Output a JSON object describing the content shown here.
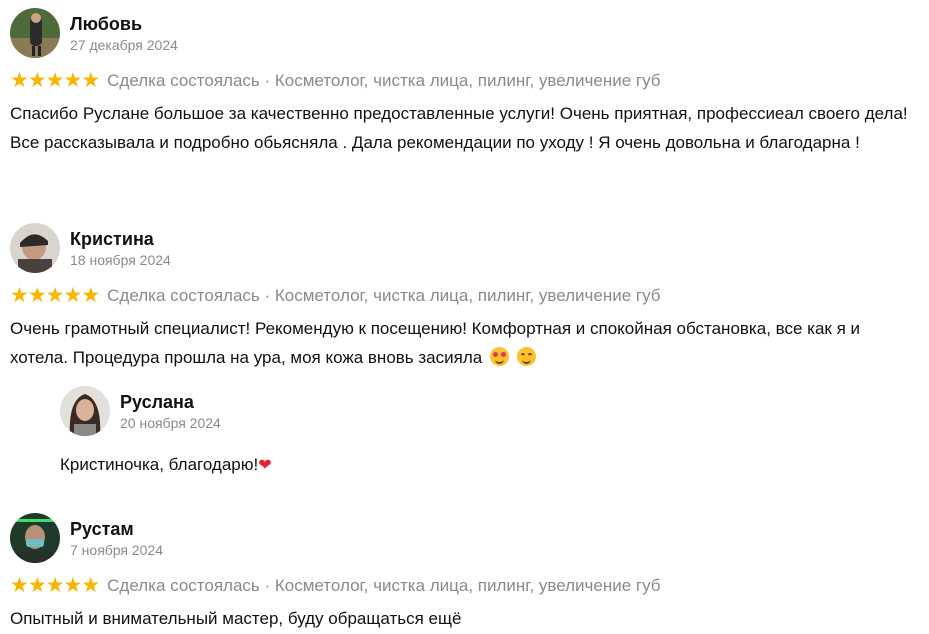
{
  "reviews": [
    {
      "name": "Любовь",
      "date": "27 декабря 2024",
      "rating": 5,
      "tags": "Сделка состоялась · Косметолог, чистка лица, пилинг, увеличение губ",
      "text": "Спасибо Руслане большое за качественно предоставленные услуги! Очень приятная, профессиеал своего дела! Все рассказывала и подробно обьясняла . Дала рекомендации по уходу ! Я очень довольна и благодарна !"
    },
    {
      "name": "Кристина",
      "date": "18 ноября 2024",
      "rating": 5,
      "tags": "Сделка состоялась · Косметолог, чистка лица, пилинг, увеличение губ",
      "text": "Очень грамотный специалист! Рекомендую к посещению! Комфортная и спокойная обстановка, все как я и хотела. Процедура прошла на ура, моя кожа вновь засияла",
      "reply": {
        "name": "Руслана",
        "date": "20 ноября 2024",
        "text": "Кристиночка, благодарю!"
      }
    },
    {
      "name": "Рустам",
      "date": "7 ноября 2024",
      "rating": 5,
      "tags": "Сделка состоялась · Косметолог, чистка лица, пилинг, увеличение губ",
      "text": "Опытный и внимательный мастер, буду обращаться ещё"
    }
  ],
  "star_glyph": "★",
  "heart_glyph": "❤",
  "colors": {
    "star": "#f7b500",
    "muted": "#8a8a8a",
    "heart": "#e8232f"
  }
}
